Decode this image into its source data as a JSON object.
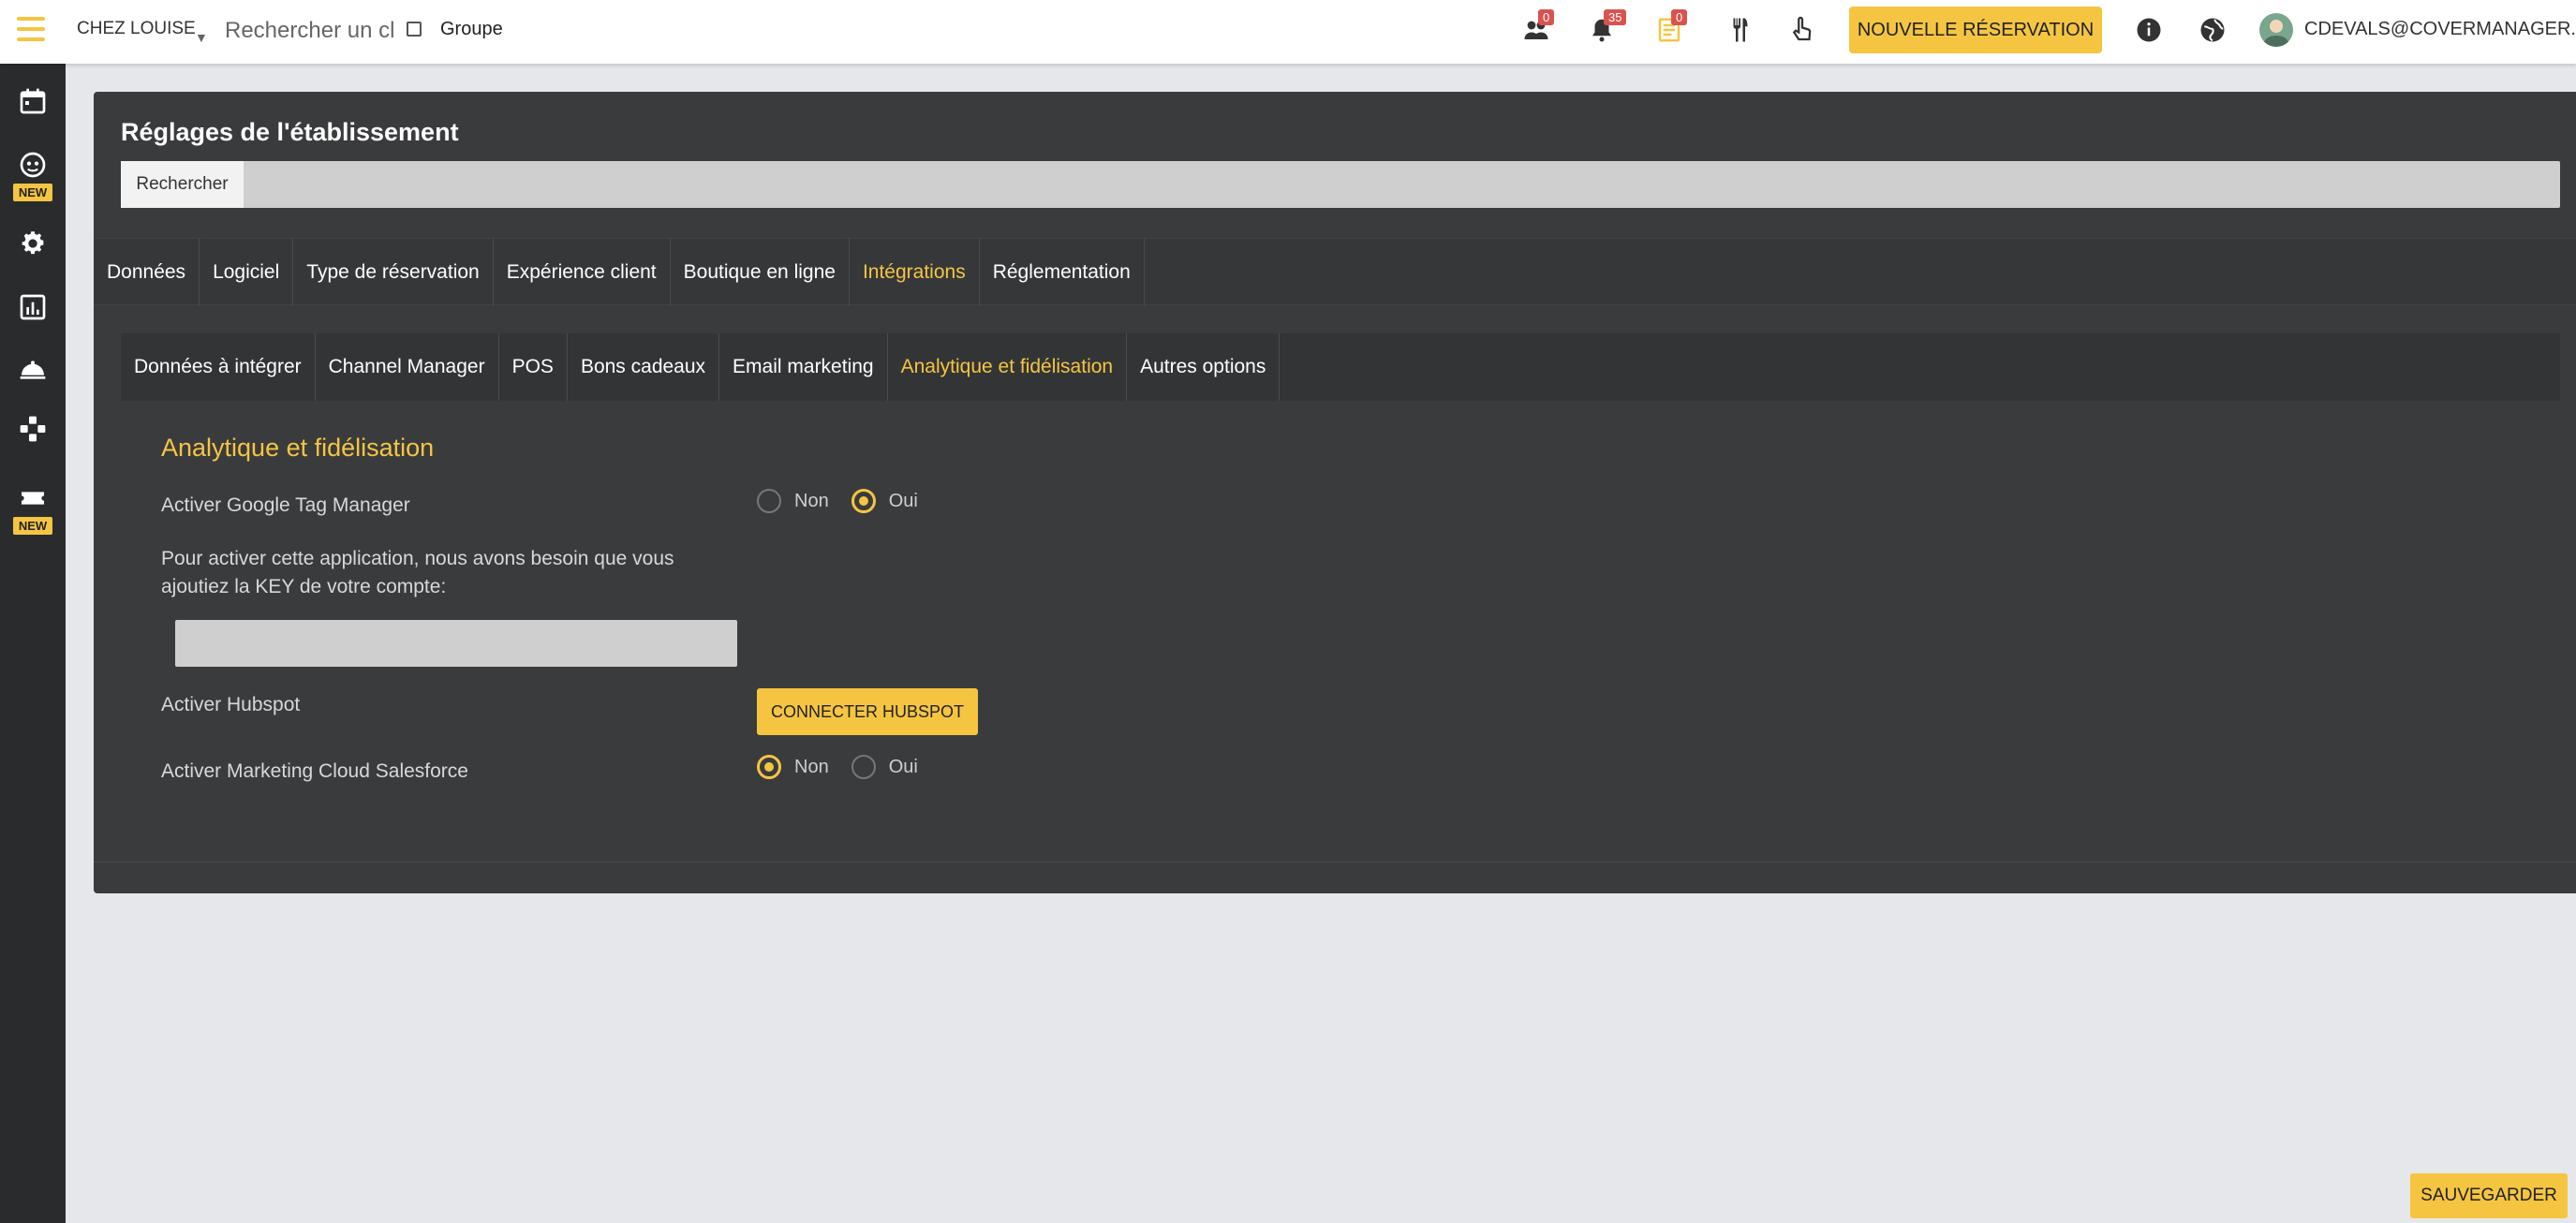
{
  "topbar": {
    "venue": "CHEZ LOUISE",
    "search_placeholder": "Rechercher un cl",
    "group_label": "Groupe",
    "badges": {
      "clients": "0",
      "notifications": "35",
      "tasks": "0"
    },
    "new_reservation": "NOUVELLE RÉSERVATION",
    "user_email": "CDEVALS@COVERMANAGER.COM",
    "accent": "#f5c542"
  },
  "sidebar": {
    "items": [
      {
        "icon": "calendar-icon"
      },
      {
        "icon": "robot-icon",
        "tag": "NEW"
      },
      {
        "icon": "gear-icon"
      },
      {
        "icon": "chart-icon"
      },
      {
        "icon": "cloche-icon"
      },
      {
        "icon": "puzzle-icon"
      },
      {
        "icon": "ticket-icon",
        "tag": "NEW"
      }
    ]
  },
  "panel": {
    "title": "Réglages de l'établissement",
    "search_button": "Rechercher",
    "tabs": [
      "Données",
      "Logiciel",
      "Type de réservation",
      "Expérience client",
      "Boutique en ligne",
      "Intégrations",
      "Réglementation"
    ],
    "active_tab": "Intégrations",
    "subtabs": [
      "Données à intégrer",
      "Channel Manager",
      "POS",
      "Bons cadeaux",
      "Email marketing",
      "Analytique et fidélisation",
      "Autres options"
    ],
    "active_subtab": "Analytique et fidélisation"
  },
  "section": {
    "title": "Analytique et fidélisation",
    "gtm_label": "Activer Google Tag Manager",
    "gtm_options": {
      "no": "Non",
      "yes": "Oui",
      "selected": "Oui"
    },
    "key_note_line1": "Pour activer cette application, nous avons besoin que vous",
    "key_note_line2": "ajoutiez la KEY de votre compte:",
    "key_value": "",
    "hubspot_label": "Activer Hubspot",
    "hubspot_button": "CONNECTER HUBSPOT",
    "salesforce_label": "Activer Marketing Cloud Salesforce",
    "salesforce_options": {
      "no": "Non",
      "yes": "Oui",
      "selected": "Non"
    }
  },
  "footer": {
    "save": "SAUVEGARDER"
  }
}
